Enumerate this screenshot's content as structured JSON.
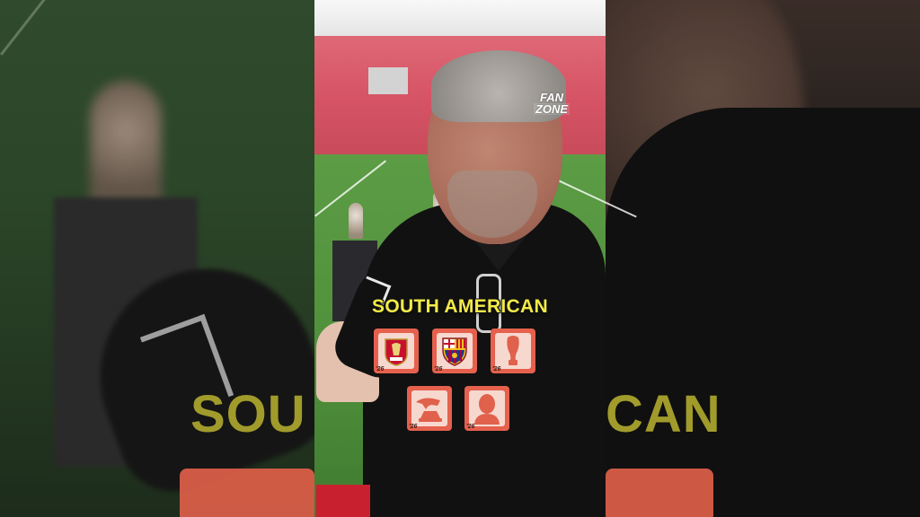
{
  "overlay": {
    "title": "SOUTH AMERICAN",
    "side_title_left": "SOU",
    "side_title_right": "CAN"
  },
  "logo": {
    "line1": "FAN",
    "line2": "ZONE"
  },
  "tiles": [
    {
      "label": "'26",
      "icon": "liverpool-crest-icon"
    },
    {
      "label": "'26",
      "icon": "barcelona-crest-icon"
    },
    {
      "label": "'26",
      "icon": "trophy-silhouette-icon"
    },
    {
      "label": "'26",
      "icon": "boot-silhouette-icon"
    },
    {
      "label": "'26",
      "icon": "player-silhouette-icon"
    }
  ],
  "colors": {
    "title_yellow": "#f3ea47",
    "tile_orange": "#e5614d",
    "tile_inner": "#f7d8cf"
  }
}
